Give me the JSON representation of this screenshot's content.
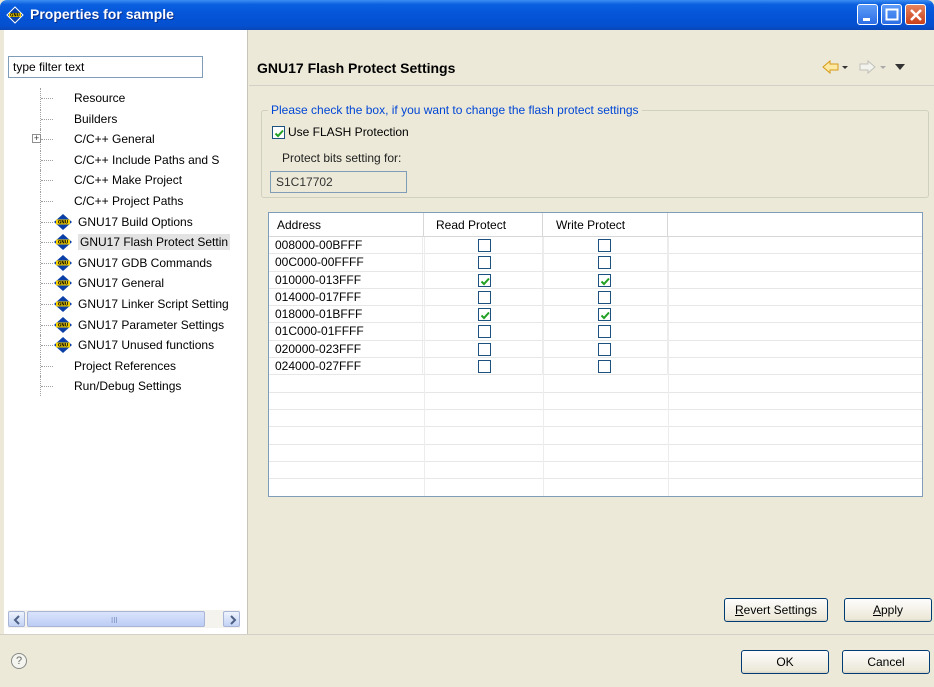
{
  "window": {
    "title": "Properties for sample"
  },
  "left": {
    "filter_placeholder": "type filter text",
    "tree": [
      {
        "label": "Resource",
        "type": "plain"
      },
      {
        "label": "Builders",
        "type": "plain"
      },
      {
        "label": "C/C++ General",
        "type": "expandable"
      },
      {
        "label": "C/C++ Include Paths and S",
        "type": "plain"
      },
      {
        "label": "C/C++ Make Project",
        "type": "plain"
      },
      {
        "label": "C/C++ Project Paths",
        "type": "plain"
      },
      {
        "label": "GNU17 Build Options",
        "type": "gnu"
      },
      {
        "label": "GNU17 Flash Protect Settin",
        "type": "gnu",
        "selected": true
      },
      {
        "label": "GNU17 GDB Commands",
        "type": "gnu"
      },
      {
        "label": "GNU17 General",
        "type": "gnu"
      },
      {
        "label": "GNU17 Linker Script Setting",
        "type": "gnu"
      },
      {
        "label": "GNU17 Parameter Settings",
        "type": "gnu"
      },
      {
        "label": "GNU17 Unused functions",
        "type": "gnu"
      },
      {
        "label": "Project References",
        "type": "plain"
      },
      {
        "label": "Run/Debug Settings",
        "type": "plain"
      }
    ],
    "scroll_grip": "III"
  },
  "right": {
    "page_title": "GNU17 Flash Protect Settings",
    "group_legend": "Please check the box, if you want to change the flash protect settings",
    "use_flash_label": "Use FLASH Protection",
    "use_flash_checked": true,
    "protect_label": "Protect bits setting for:",
    "chip_value": "S1C17702",
    "table": {
      "headers": [
        "Address",
        "Read Protect",
        "Write Protect"
      ],
      "rows": [
        {
          "address": "008000-00BFFF",
          "read": false,
          "write": false
        },
        {
          "address": "00C000-00FFFF",
          "read": false,
          "write": false
        },
        {
          "address": "010000-013FFF",
          "read": true,
          "write": true
        },
        {
          "address": "014000-017FFF",
          "read": false,
          "write": false
        },
        {
          "address": "018000-01BFFF",
          "read": true,
          "write": true
        },
        {
          "address": "01C000-01FFFF",
          "read": false,
          "write": false
        },
        {
          "address": "020000-023FFF",
          "read": false,
          "write": false
        },
        {
          "address": "024000-027FFF",
          "read": false,
          "write": false
        }
      ],
      "empty_rows": 6
    },
    "revert_label_pre": "",
    "revert_label_u": "R",
    "revert_label_post": "evert Settings",
    "apply_label_u": "A",
    "apply_label_post": "pply"
  },
  "footer": {
    "help_glyph": "?",
    "ok_label": "OK",
    "cancel_label": "Cancel"
  },
  "colors": {
    "titlebar": "#0554d8",
    "legend": "#0046d5",
    "check": "#2aa02a"
  }
}
